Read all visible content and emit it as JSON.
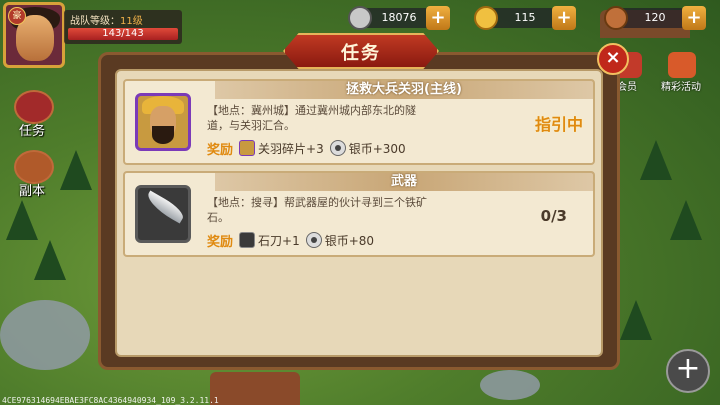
{
  "hud": {
    "vip_badge": "豪",
    "team_level_label": "战队等级：",
    "team_level_value": "11级",
    "hp_text": "143/143",
    "hp_fraction": 1.0,
    "silver_value": "18076",
    "gold_value": "115",
    "stamina_value": "120",
    "plus_symbol": "+"
  },
  "side_menu": {
    "tasks_label": "任务",
    "dungeon_label": "副本"
  },
  "right_menu": {
    "member_label": "会员",
    "events_label": "精彩活动"
  },
  "dialog": {
    "title": "任务",
    "close_symbol": "×",
    "quests": [
      {
        "title": "拯救大兵关羽(主线)",
        "description": "【地点：冀州城】通过冀州城内部东北的隧道，与关羽汇合。",
        "reward_label": "奖励",
        "rewards": [
          {
            "icon": "general-shard-icon",
            "text": "关羽碎片+3"
          },
          {
            "icon": "silver-coin-icon",
            "text": "银币+300"
          }
        ],
        "status": "指引中"
      },
      {
        "title": "武器",
        "description": "【地点：搜寻】帮武器屋的伙计寻到三个铁矿石。",
        "reward_label": "奖励",
        "rewards": [
          {
            "icon": "stone-blade-icon",
            "text": "石刀+1"
          },
          {
            "icon": "silver-coin-icon",
            "text": "银币+80"
          }
        ],
        "status": "0/3"
      }
    ]
  },
  "footer": {
    "add_symbol": "+",
    "version_text": "4CE976314694EBAE3FC8AC4364940934_109_3.2.11.1"
  },
  "colors": {
    "accent_orange": "#e08a10",
    "dialog_title_red": "#c03a22",
    "panel_parchment": "#e7d8b8"
  }
}
